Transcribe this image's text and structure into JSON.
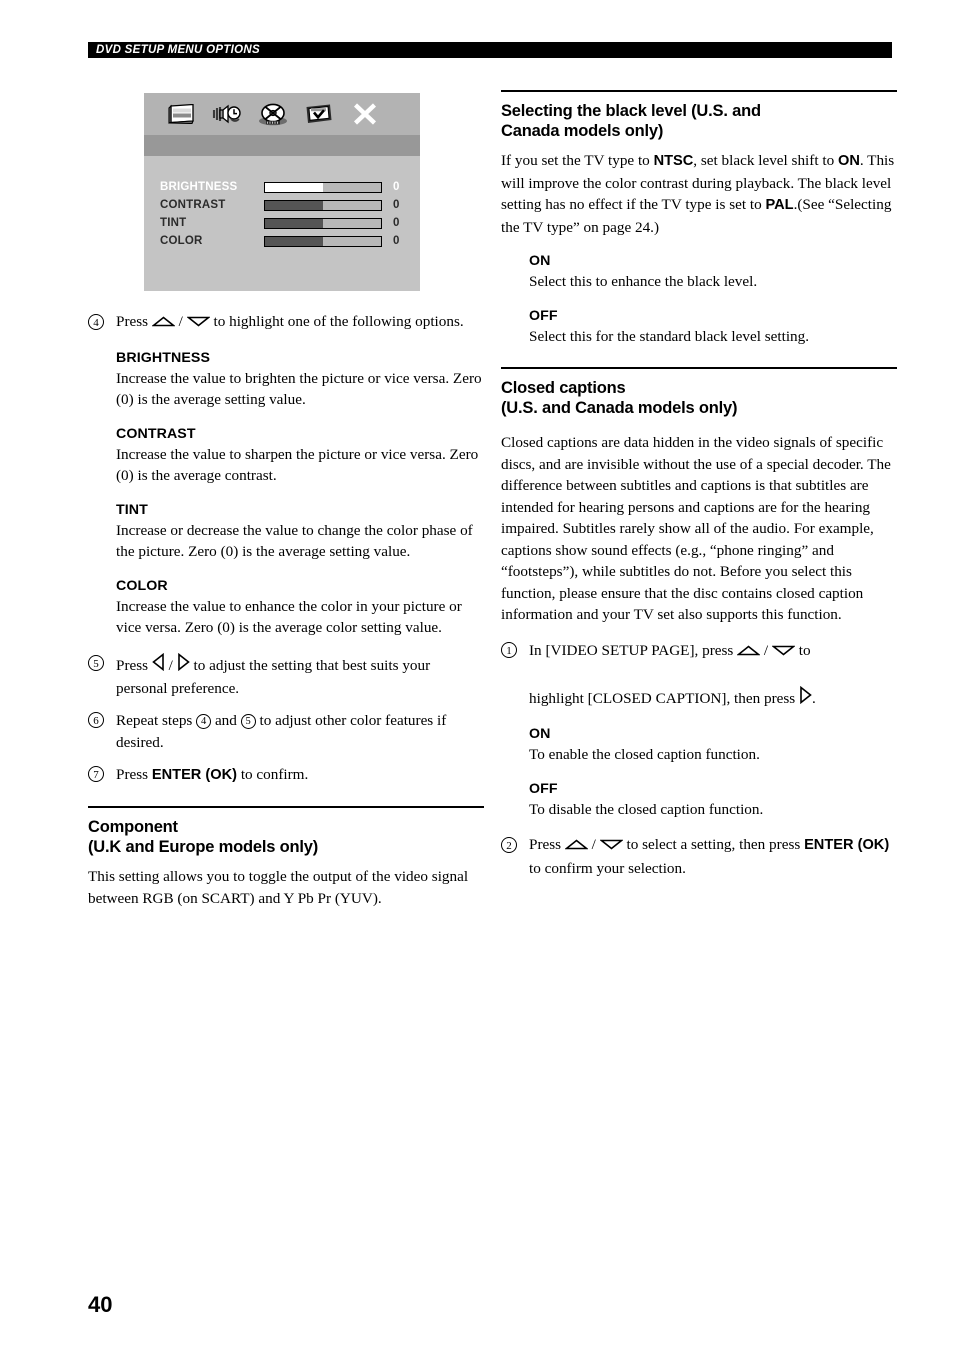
{
  "header": {
    "running_title": "DVD SETUP MENU OPTIONS"
  },
  "page_number": "40",
  "osd": {
    "icons": [
      {
        "name": "tv-display-icon",
        "label": "TV / General Setup"
      },
      {
        "name": "speaker-audio-icon",
        "label": "Audio Setup"
      },
      {
        "name": "disc-video-icon",
        "label": "Video Setup"
      },
      {
        "name": "preferences-icon",
        "label": "Preference Setup"
      },
      {
        "name": "close-x-icon",
        "label": "Exit Setup"
      }
    ],
    "rows": [
      {
        "label": "BRIGHTNESS",
        "value": "0",
        "fill_percent": 50,
        "selected": true
      },
      {
        "label": "CONTRAST",
        "value": "0",
        "fill_percent": 50,
        "selected": false
      },
      {
        "label": "TINT",
        "value": "0",
        "fill_percent": 50,
        "selected": false
      },
      {
        "label": "COLOR",
        "value": "0",
        "fill_percent": 50,
        "selected": false
      }
    ]
  },
  "left_column": {
    "step4": {
      "number": "4",
      "text_before": "Press",
      "text_after": "to highlight one of the following options."
    },
    "options": [
      {
        "title": "BRIGHTNESS",
        "body": "Increase the value to brighten the picture or vice versa. Zero (0) is the average setting value."
      },
      {
        "title": "CONTRAST",
        "body": "Increase the value to sharpen the picture or vice versa. Zero (0) is the average contrast."
      },
      {
        "title": "TINT",
        "body": "Increase or decrease the value to change the color phase of the picture. Zero (0) is the average setting value."
      },
      {
        "title": "COLOR",
        "body": "Increase the value to enhance the color in your picture or vice versa. Zero (0) is the average color setting value."
      }
    ],
    "step5": {
      "number": "5",
      "text_before": "Press",
      "text_after": "to adjust the setting that best suits your personal preference."
    },
    "step6": {
      "number": "6",
      "text_a": "Repeat steps",
      "ref_a": "4",
      "text_b": "and",
      "ref_b": "5",
      "text_c": "to adjust other color features if desired."
    },
    "step7": {
      "number": "7",
      "text_before": "Press",
      "bold": "ENTER (OK)",
      "text_after": "to confirm."
    },
    "component_section": {
      "heading_line1": "Component",
      "heading_line2": "(U.K and Europe models only)",
      "body": "This setting allows you to toggle the output of the video signal between RGB (on SCART) and Y Pb Pr (YUV)."
    }
  },
  "right_column": {
    "black_level_section": {
      "heading_line1": "Selecting the black level (U.S. and",
      "heading_line2": "Canada models only)",
      "body_p1": "If you set the TV type to ",
      "body_b1": "NTSC",
      "body_p2": ", set black level shift to ",
      "body_b2": "ON",
      "body_p3": ". This will improve the color contrast during playback. The black level setting has no effect if the TV type is set to ",
      "body_b3": "PAL",
      "body_p4": ".(See “Selecting the TV type” on page 24.)",
      "options": [
        {
          "title": "ON",
          "body": "Select this to enhance the black level."
        },
        {
          "title": "OFF",
          "body": "Select this for the standard black level setting."
        }
      ]
    },
    "closed_captions_section": {
      "heading_line1": "Closed captions",
      "heading_line2": "(U.S. and Canada models only)",
      "body": "Closed captions are data hidden in the video signals of specific discs, and are invisible without the use of a special decoder. The difference between subtitles and captions is that subtitles are intended for hearing persons and captions are for the hearing impaired. Subtitles rarely show all of the audio. For example, captions show sound effects (e.g., “phone ringing” and “footsteps”), while subtitles do not. Before you select this function, please ensure that the disc contains closed caption information and your TV set also supports this function.",
      "step1": {
        "number": "1",
        "text_a": "In [VIDEO SETUP PAGE], press",
        "text_b": "to",
        "text_c": "highlight [CLOSED CAPTION], then press",
        "text_d": "."
      },
      "options": [
        {
          "title": "ON",
          "body": "To enable the closed caption function."
        },
        {
          "title": "OFF",
          "body": "To disable the closed caption function."
        }
      ],
      "step2": {
        "number": "2",
        "text_before": "Press",
        "text_mid": "to select a setting, then press",
        "bold": "ENTER (OK)",
        "text_after": "to confirm your selection."
      }
    }
  }
}
